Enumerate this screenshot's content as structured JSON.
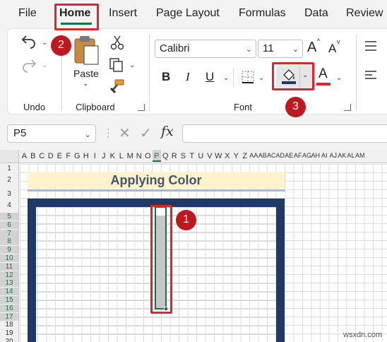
{
  "menu": {
    "tabs": [
      "File",
      "Home",
      "Insert",
      "Page Layout",
      "Formulas",
      "Data",
      "Review"
    ],
    "active_index": 1
  },
  "ribbon": {
    "undo_group_label": "Undo",
    "clipboard": {
      "paste_label": "Paste",
      "group_label": "Clipboard"
    },
    "font": {
      "font_name": "Calibri",
      "font_size": "11",
      "bold": "B",
      "italic": "I",
      "underline": "U",
      "grow_font": "A",
      "shrink_font": "A",
      "font_color_glyph": "A",
      "group_label": "Font",
      "fill_color_hex": "#203864",
      "font_color_hex": "#e0242b"
    }
  },
  "formula_bar": {
    "name_box": "P5",
    "fx_label": "fx",
    "formula": ""
  },
  "sheet": {
    "columns": [
      "A",
      "B",
      "C",
      "D",
      "E",
      "F",
      "G",
      "H",
      "I",
      "J",
      "K",
      "L",
      "M",
      "N",
      "O",
      "P",
      "Q",
      "R",
      "S",
      "T",
      "U",
      "V",
      "W",
      "X",
      "Y",
      "Z",
      "AA",
      "AB",
      "AC",
      "AD",
      "AE",
      "AF",
      "AG",
      "AH",
      "AI",
      "AJ",
      "AK",
      "AL",
      "AM"
    ],
    "selected_column": "P",
    "rows": [
      "1",
      "2",
      "3",
      "4",
      "5",
      "6",
      "7",
      "8",
      "9",
      "10",
      "11",
      "12",
      "13",
      "14",
      "15",
      "16",
      "17",
      "18",
      "19",
      "20"
    ],
    "selected_rows": [
      "5",
      "6",
      "7",
      "8",
      "9",
      "10",
      "11",
      "12",
      "13",
      "14",
      "15",
      "16",
      "17"
    ],
    "title_text": "Applying Color"
  },
  "annotations": {
    "step1": "1",
    "step2": "2",
    "step3": "3"
  },
  "watermark": "wsxdn.com"
}
